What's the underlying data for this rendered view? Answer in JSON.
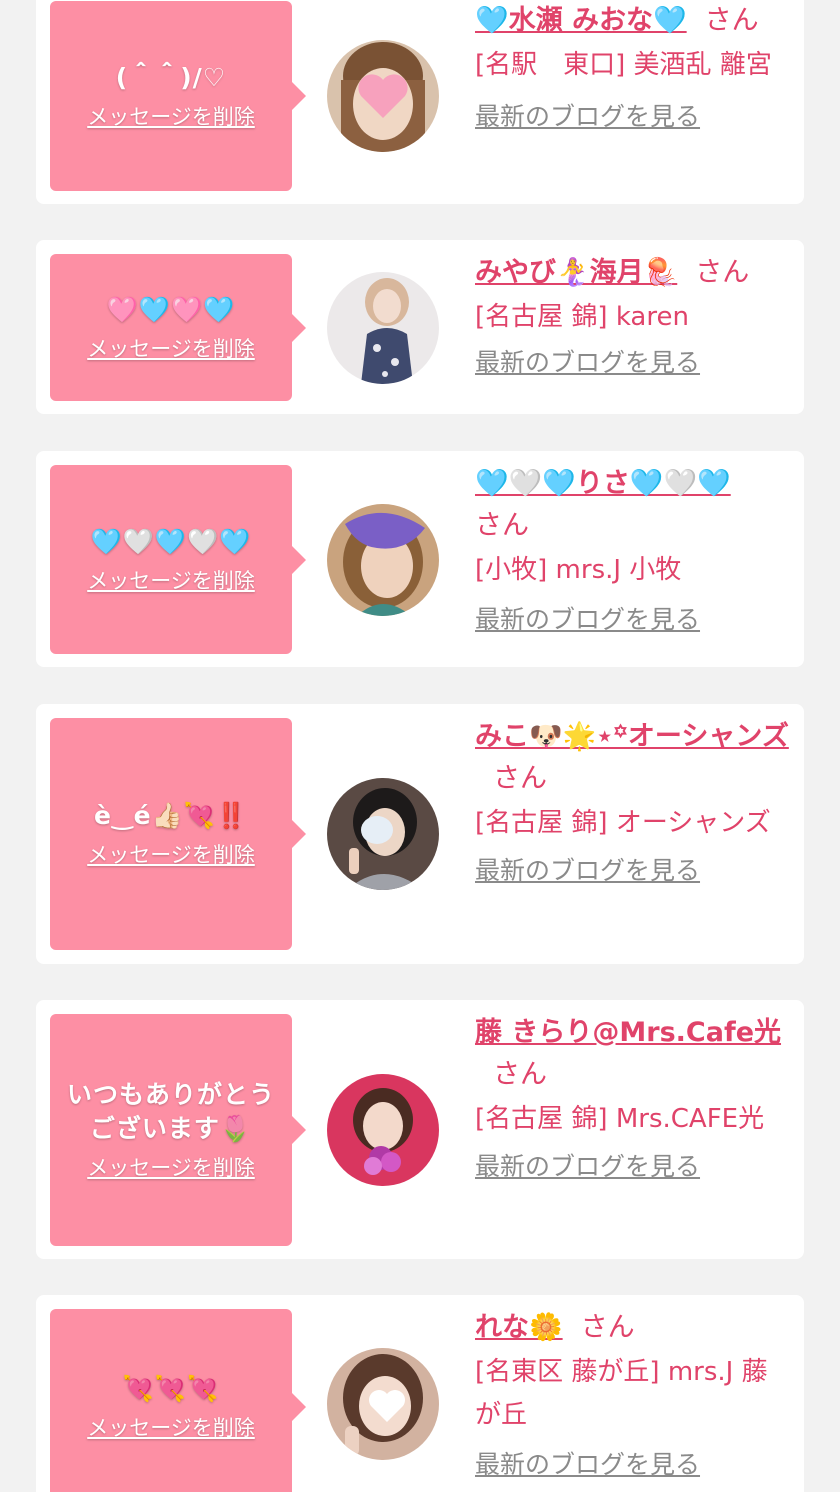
{
  "common": {
    "delete_label": "メッセージを削除",
    "san_label": "さん",
    "blog_label": "最新のブログを見る"
  },
  "colors": {
    "accent_pink": "#e0436a",
    "bubble_pink": "#fd8fa4",
    "link_gray": "#8a8a8a",
    "page_bg": "#f2f2f2"
  },
  "items": [
    {
      "message": "(＾＾)/♡",
      "name": "🩵水瀬 みおな🩵",
      "shop": "[名駅　東口] 美酒乱 離宮",
      "avatar": "photo-avatar"
    },
    {
      "message": "🩷🩵🩷🩵",
      "name": "みやび🧜‍♀️海月🪼",
      "shop": "[名古屋 錦] karen",
      "avatar": "photo-avatar"
    },
    {
      "message": "🩵🤍🩵🤍🩵",
      "name": "🩵🤍🩵りさ🩵🤍🩵",
      "shop": "[小牧] mrs.J 小牧",
      "avatar": "photo-avatar"
    },
    {
      "message": "è‿é👍🏻💘‼️",
      "name": "みこ🐶🌟⋆꙳オーシャンズ",
      "shop": "[名古屋 錦] オーシャンズ",
      "avatar": "photo-avatar"
    },
    {
      "message": "いつもありがとうございます🌷",
      "name": "藤 きらり@Mrs.Cafe光",
      "shop": "[名古屋 錦] Mrs.CAFE光",
      "avatar": "photo-avatar"
    },
    {
      "message": "💘💘💘",
      "name": "れな🌼",
      "shop": "[名東区 藤が丘] mrs.J 藤が丘",
      "avatar": "photo-avatar"
    }
  ]
}
